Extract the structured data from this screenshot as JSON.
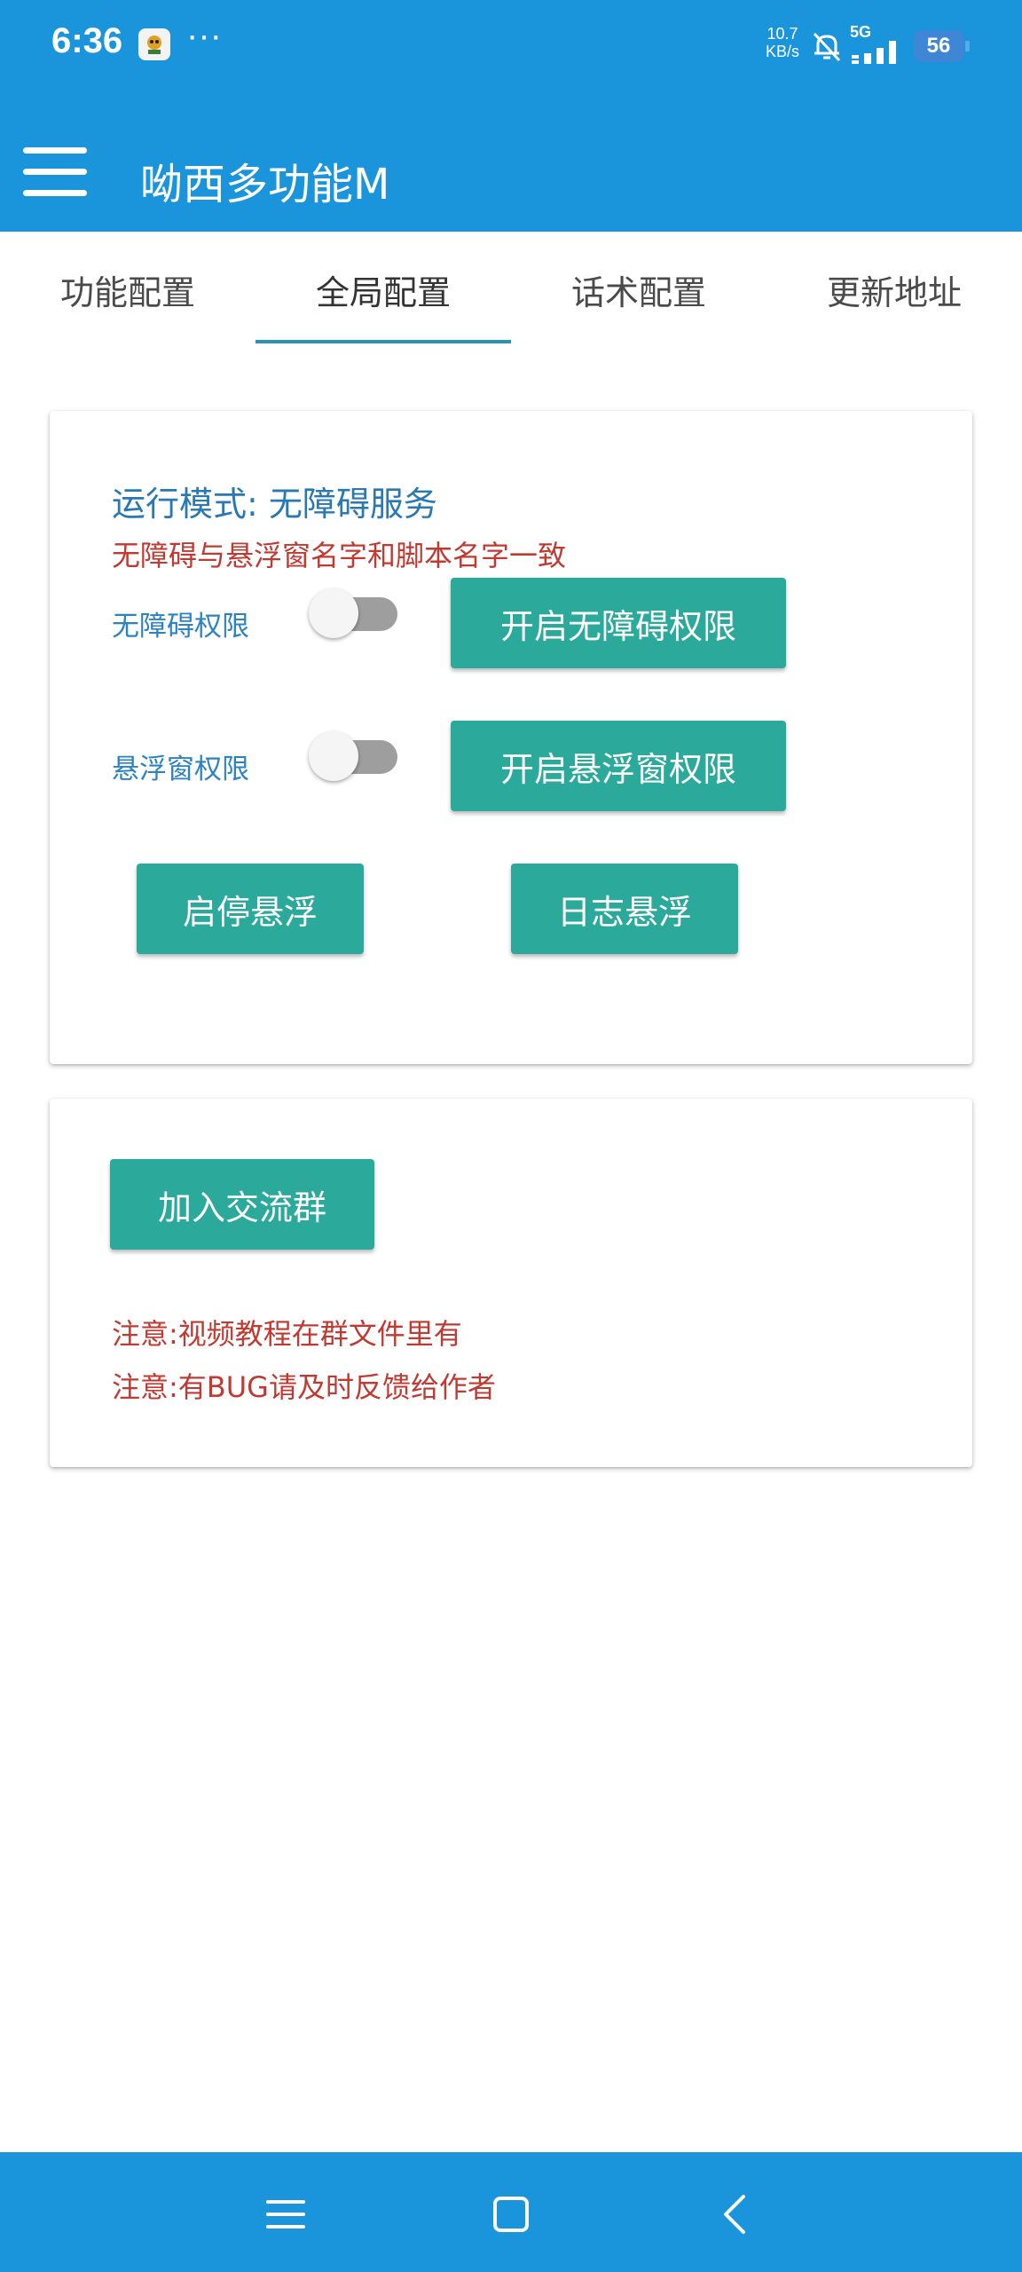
{
  "status_bar": {
    "time": "6:36",
    "more": "···",
    "net_speed_value": "10.7",
    "net_speed_unit": "KB/s",
    "network": "5G",
    "battery": "56"
  },
  "app_bar": {
    "title": "呦西多功能M"
  },
  "tabs": [
    {
      "label": "功能配置",
      "active": false
    },
    {
      "label": "全局配置",
      "active": true
    },
    {
      "label": "话术配置",
      "active": false
    },
    {
      "label": "更新地址",
      "active": false
    }
  ],
  "settings_card": {
    "mode_label": "运行模式: 无障碍服务",
    "warning": "无障碍与悬浮窗名字和脚本名字一致",
    "accessibility_label": "无障碍权限",
    "accessibility_enabled": false,
    "accessibility_button": "开启无障碍权限",
    "overlay_label": "悬浮窗权限",
    "overlay_enabled": false,
    "overlay_button": "开启悬浮窗权限",
    "toggle_float_button": "启停悬浮",
    "log_float_button": "日志悬浮"
  },
  "group_card": {
    "join_button": "加入交流群",
    "note_1": "注意:视频教程在群文件里有",
    "note_2": "注意:有BUG请及时反馈给作者"
  },
  "colors": {
    "primary": "#1a95dc",
    "accent": "#2ba99a",
    "tab_indicator": "#2a93b5",
    "mode_text": "#2878b4",
    "warning_text": "#c03a32"
  }
}
